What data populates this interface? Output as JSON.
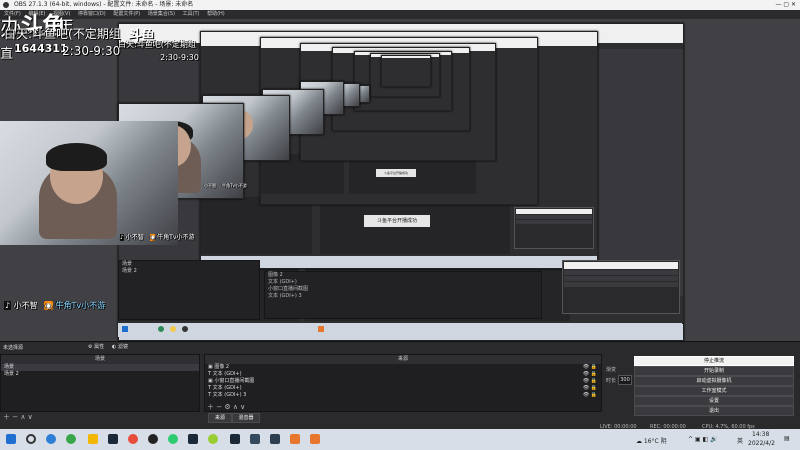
{
  "window": {
    "title": "OBS 27.1.3 (64-bit, windows) - 配置文件: 未命名 - 场景: 未命名"
  },
  "menu": [
    "文件(F)",
    "编辑(E)",
    "视图(V)",
    "停靠窗口(D)",
    "配置文件(P)",
    "场景集合(S)",
    "工具(T)",
    "帮助(H)"
  ],
  "overlay": {
    "big_line1": "办",
    "big_line1b": "年",
    "brand": "斗鱼",
    "brand_sub": "DOUYU.COM",
    "room_id": "1644311",
    "big_line2": "白天:斗鱼吧(不定期组",
    "big_line3": "直",
    "schedule": "2:30-9:30",
    "mini_line2": "白天:斗鱼吧(不定期组",
    "mini_time": "2:30-9:30",
    "tiktok_handle1": "小不智",
    "huya_handle1": "牛角Tv小不游",
    "tiktok_handle2": "小不智",
    "huya_handle2": "牛角Tv小不游",
    "small_tiktok": "小不智",
    "small_huya": "牛角Tv小不游"
  },
  "nested": {
    "toast1": "斗鱼平台开播成功",
    "toast2": "斗鱼平台开播成功"
  },
  "dock": {
    "scene_panel_label": "未选择源",
    "properties_btn": "属性",
    "filters_btn": "滤镜",
    "scenes_header": "场景",
    "scenes": [
      "场景",
      "场景 2"
    ],
    "sources_header": "来源",
    "sources": [
      {
        "icon": "image-icon",
        "name": "图像 2"
      },
      {
        "icon": "text-icon",
        "name": "文本 (GDI+)"
      },
      {
        "icon": "image-icon",
        "name": "小窗口直播间截图"
      },
      {
        "icon": "text-icon",
        "name": "文本 (GDI+)"
      },
      {
        "icon": "text-icon",
        "name": "文本 (GDI+) 3"
      }
    ],
    "mixer_tab": "来源",
    "transitions_tab": "混音器",
    "controls": {
      "stop_stream": "停止推流",
      "start_record": "开始录制",
      "virtual_cam": "启动虚拟摄像机",
      "studio_mode": "工作室模式",
      "settings": "设置",
      "exit": "退出"
    },
    "transition_label": "渐变",
    "duration_label": "时长",
    "duration_value": "300"
  },
  "statusbar": {
    "fps": "LIVE: 00:00:00",
    "rec": "REC: 00:00:00",
    "cpu": "CPU: 4.7%, 60.00 fps"
  },
  "taskbar": {
    "weather": "16°C 阴",
    "time": "14:38",
    "date": "2022/4/2",
    "lang": "英"
  },
  "colors": {
    "obs_bg": "#3c3c3f",
    "panel_bg": "#1f1f22",
    "taskbar": "#d7dee8",
    "accent_button": "#f2f2f2"
  }
}
